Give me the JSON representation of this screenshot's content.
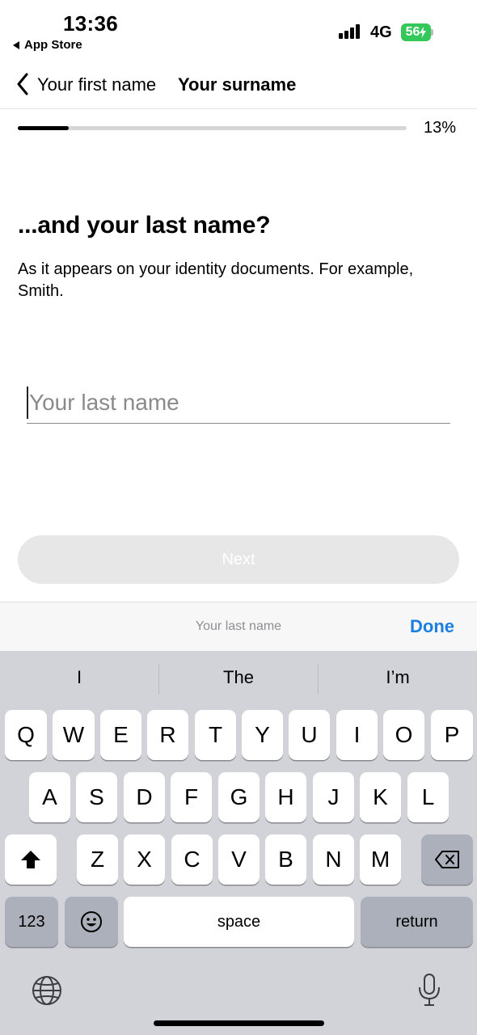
{
  "status_bar": {
    "time": "13:36",
    "back_app_label": "App Store",
    "network": "4G",
    "battery": "56",
    "battery_color": "#34c759"
  },
  "nav": {
    "previous_label": "Your first name",
    "current_label": "Your surname"
  },
  "progress": {
    "percent_value": 13,
    "label": "13%"
  },
  "content": {
    "heading": "...and your last name?",
    "subtext": "As it appears on your identity documents. For example, Smith.",
    "input_value": "",
    "input_placeholder": "Your last name",
    "next_label": "Next"
  },
  "accessory_bar": {
    "hint": "Your last name",
    "done_label": "Done",
    "done_color": "#1a7fe0"
  },
  "keyboard": {
    "suggestions": [
      "I",
      "The",
      "I’m"
    ],
    "row1": [
      "Q",
      "W",
      "E",
      "R",
      "T",
      "Y",
      "U",
      "I",
      "O",
      "P"
    ],
    "row2": [
      "A",
      "S",
      "D",
      "F",
      "G",
      "H",
      "J",
      "K",
      "L"
    ],
    "row3": [
      "Z",
      "X",
      "C",
      "V",
      "B",
      "N",
      "M"
    ],
    "numbers_label": "123",
    "space_label": "space",
    "return_label": "return",
    "icons": [
      "shift-icon",
      "backspace-icon",
      "emoji-icon",
      "globe-icon",
      "microphone-icon"
    ]
  }
}
